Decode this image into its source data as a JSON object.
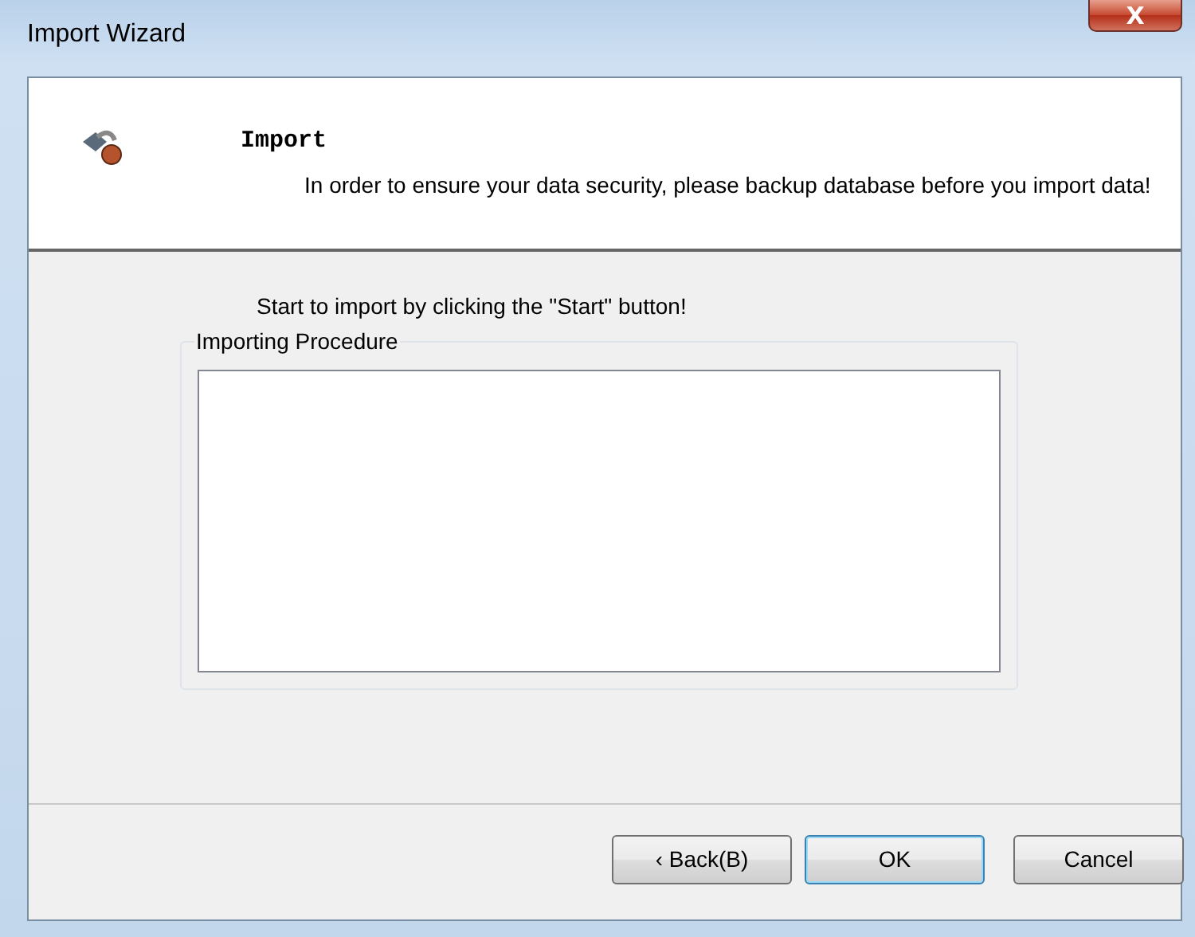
{
  "window": {
    "title": "Import Wizard",
    "close": "X"
  },
  "header": {
    "title": "Import",
    "description": "In order to ensure your data security, please backup database before you import data!"
  },
  "instruction": "Start to import by clicking the \"Start\" button!",
  "procedure": {
    "label": "Importing Procedure"
  },
  "buttons": [
    {
      "label": "‹ Back(B)",
      "default": false
    },
    {
      "label": "OK",
      "default": true
    },
    {
      "label": "Cancel",
      "default": false
    }
  ]
}
